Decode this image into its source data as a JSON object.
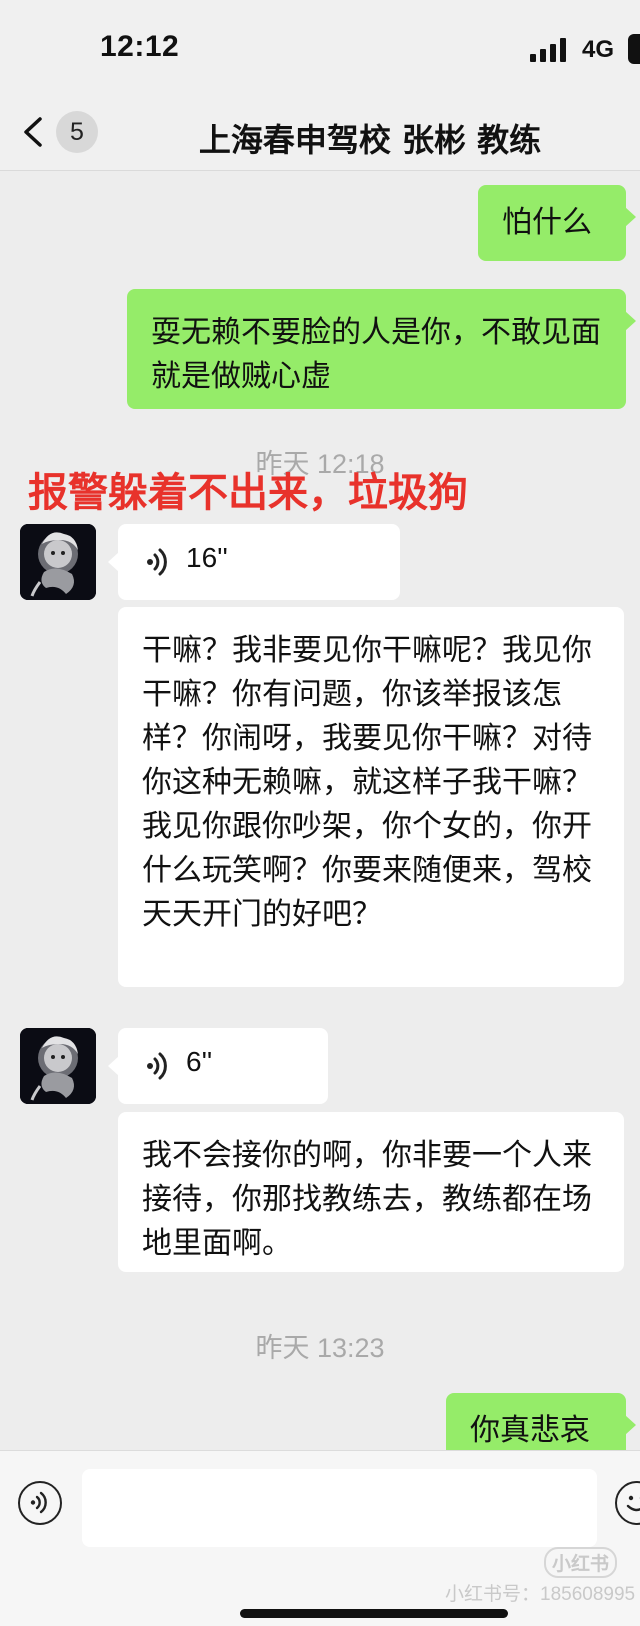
{
  "status_bar": {
    "time": "12:12",
    "network": "4G"
  },
  "nav": {
    "back_count": "5",
    "title": "上海春申驾校 张彬 教练"
  },
  "overlay_text": "报警躲着不出来，垃圾狗",
  "messages": {
    "m1": "怕什么",
    "m2": "耍无赖不要脸的人是你，不敢见面就是做贼心虚",
    "ts1": "昨天 12:18",
    "voice1": "16''",
    "m3": "干嘛？我非要见你干嘛呢？我见你干嘛？你有问题，你该举报该怎样？你闹呀，我要见你干嘛？对待你这种无赖嘛，就这样子我干嘛？我见你跟你吵架，你个女的，你开什么玩笑啊？你要来随便来，驾校天天开门的好吧？",
    "voice2": "6''",
    "m4": "我不会接你的啊，你非要一个人来接待，你那找教练去，教练都在场地里面啊。",
    "ts2": "昨天 13:23",
    "m5": "你真悲哀"
  },
  "input_bar": {
    "value": ""
  },
  "watermark": {
    "app": "小红书",
    "user": "小红书号：185608995"
  },
  "colors": {
    "outgoing": "#95ec69",
    "incoming": "#ffffff",
    "background": "#ededed",
    "overlay_red": "#e8322b"
  },
  "icons": [
    "back-chevron-icon",
    "signal-icon",
    "battery-icon",
    "voice-wave-icon",
    "voice-input-icon",
    "emoji-icon"
  ]
}
